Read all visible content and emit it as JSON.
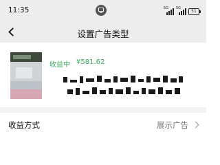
{
  "status_bar": {
    "time": "11:35",
    "sim1_tag": "5G",
    "sim2_tag": "5G",
    "battery": "51",
    "app_icon": "monitor-icon"
  },
  "nav": {
    "back_icon": "back-arrow-icon",
    "title": "设置广告类型"
  },
  "ad_card": {
    "status": "收益中",
    "amount": "¥581.62",
    "accent_color": "#3aab5c"
  },
  "settings": {
    "method_label": "收益方式",
    "method_value": "展示广告",
    "chevron_icon": "chevron-right-icon"
  }
}
